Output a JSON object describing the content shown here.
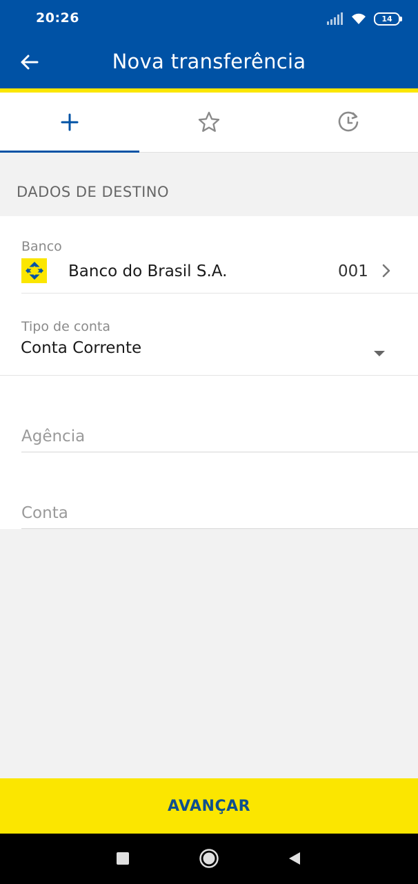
{
  "status_bar": {
    "time": "20:26",
    "battery": "14"
  },
  "header": {
    "title": "Nova transferência"
  },
  "tabs": [
    {
      "icon": "plus-icon",
      "active": true
    },
    {
      "icon": "star-icon",
      "active": false
    },
    {
      "icon": "history-icon",
      "active": false
    }
  ],
  "section": {
    "title": "DADOS DE DESTINO"
  },
  "form": {
    "bank": {
      "label": "Banco",
      "name": "Banco do Brasil S.A.",
      "code": "001"
    },
    "account_type": {
      "label": "Tipo de conta",
      "value": "Conta Corrente"
    },
    "agency": {
      "placeholder": "Agência"
    },
    "account": {
      "placeholder": "Conta"
    }
  },
  "footer": {
    "next_label": "AVANÇAR"
  },
  "colors": {
    "primary": "#0052a5",
    "accent": "#fbe600"
  }
}
